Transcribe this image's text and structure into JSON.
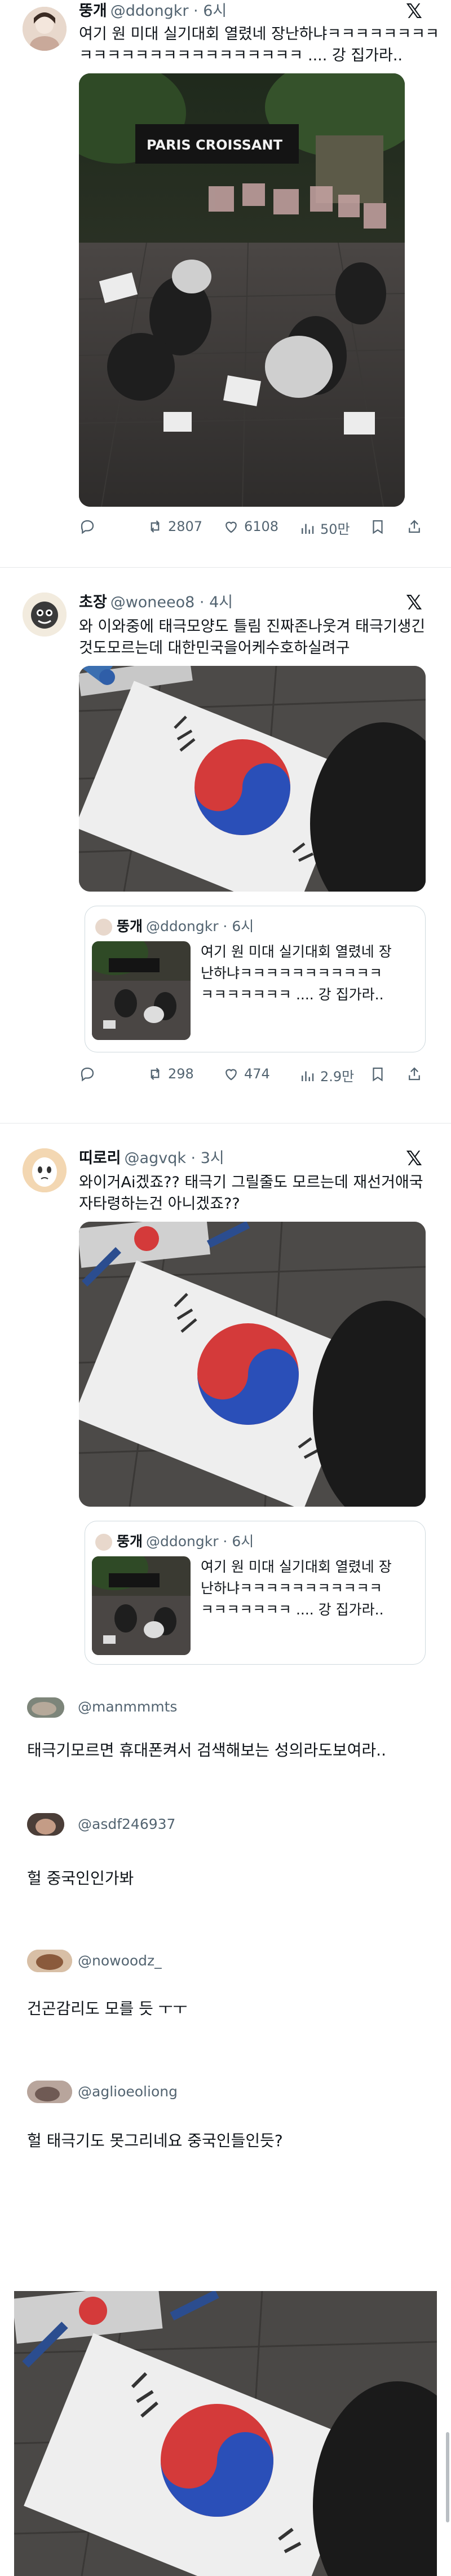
{
  "post1": {
    "name": "뚱개",
    "handle": "@ddongkr · 6시",
    "text": [
      "여기 원 미대 실기대회 열렸네 장난하냐ㅋㅋㅋㅋㅋㅋㅋㅋ",
      "ㅋㅋㅋㅋㅋㅋㅋㅋㅋㅋㅋㅋㅋㅋㅋㅋ .... 강 집가라.."
    ],
    "sign_text": "PARIS CROISSANT",
    "stats": {
      "replies": "",
      "retweets": "2807",
      "likes": "6108",
      "views": "50만"
    }
  },
  "post2": {
    "name": "초장",
    "handle": "@woneeo8 · 4시",
    "text": [
      "와 이와중에 태극모양도 틀림 진짜존나웃겨 태극기생긴",
      "것도모르는데 대한민국을어케수호하실려구"
    ],
    "stats": {
      "replies": "",
      "retweets": "298",
      "likes": "474",
      "views": "2.9만"
    }
  },
  "quote": {
    "name": "뚱개",
    "handle": "@ddongkr · 6시",
    "text": [
      "여기 원 미대 실기대회 열렸네 장",
      "난하냐ㅋㅋㅋㅋㅋㅋㅋㅋㅋㅋㅋ",
      "ㅋㅋㅋㅋㅋㅋㅋ .... 강 집가라.."
    ]
  },
  "post3": {
    "name": "띠로리",
    "handle": "@agvqk · 3시",
    "text": [
      "와이거Ai겠죠?? 태극기 그릴줄도 모르는데 재선거애국",
      "자타령하는건 아니겠죠??"
    ]
  },
  "comments": [
    {
      "name": "@manmmmts",
      "text": "태극기모르면 휴대폰켜서 검색해보는 성의라도보여라.."
    },
    {
      "name": "@asdf246937",
      "text": "헐 중국인인가봐"
    },
    {
      "name": "@nowoodz_",
      "text": "건곤감리도 모를 듯 ㅜㅜ"
    },
    {
      "name": "@aglioeoliong",
      "text": "헐 태극기도 못그리네요 중국인들인듯?"
    }
  ],
  "x_logo": "𝕏"
}
